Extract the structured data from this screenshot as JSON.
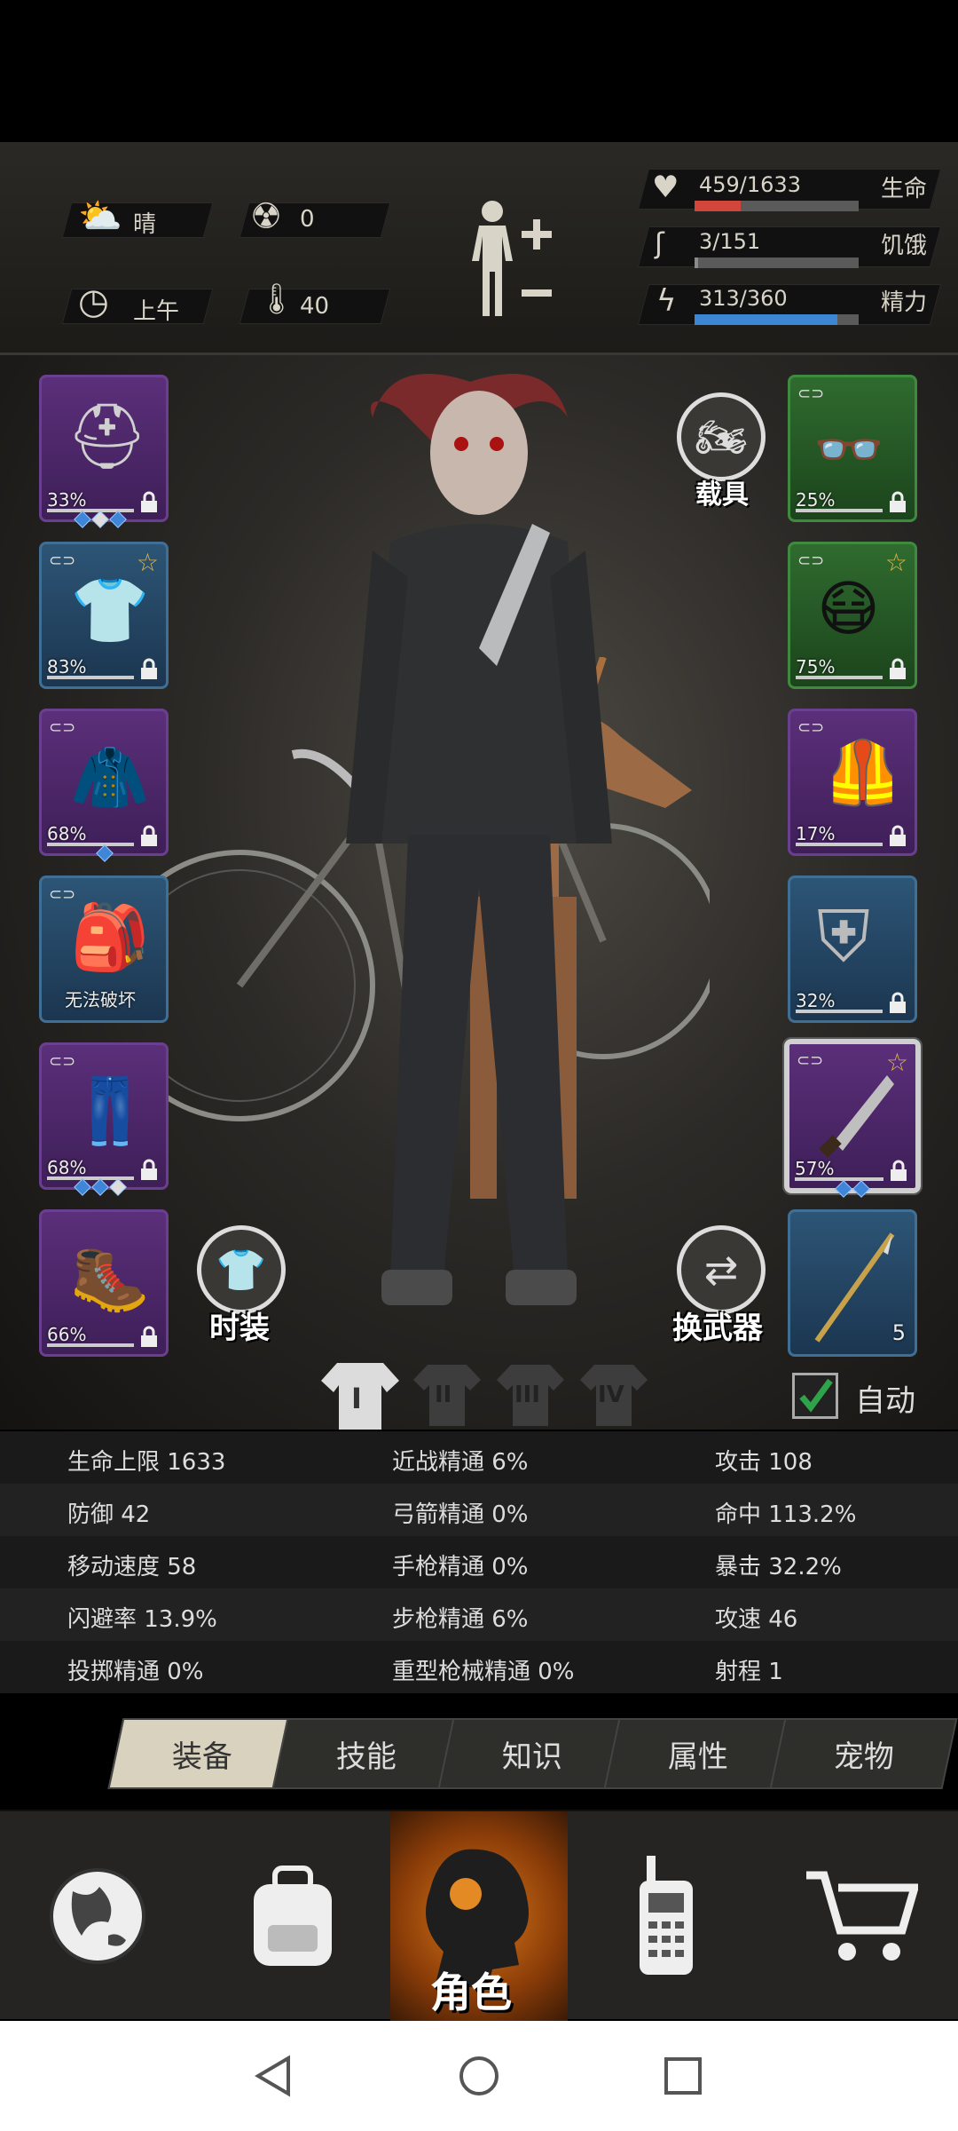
{
  "status": {
    "weather": "晴",
    "radiation": "0",
    "time_of_day": "上午",
    "temperature": "40",
    "hp": {
      "label": "生命",
      "text": "459/1633",
      "current": 459,
      "max": 1633,
      "color": "#d1453a"
    },
    "hunger": {
      "label": "饥饿",
      "text": "3/151",
      "current": 3,
      "max": 151,
      "color": "#8a8a8a"
    },
    "energy": {
      "label": "精力",
      "text": "313/360",
      "current": 313,
      "max": 360,
      "color": "#3d86d4"
    }
  },
  "equipment_left": [
    {
      "name": "helmet",
      "pct": "33%"
    },
    {
      "name": "shirt",
      "pct": "83%"
    },
    {
      "name": "jacket",
      "pct": "68%"
    },
    {
      "name": "backpack",
      "pct": "无法破坏"
    },
    {
      "name": "pants",
      "pct": "68%"
    },
    {
      "name": "boots",
      "pct": "66%"
    }
  ],
  "equipment_right": [
    {
      "name": "glasses",
      "pct": "25%"
    },
    {
      "name": "mask",
      "pct": "75%"
    },
    {
      "name": "vest",
      "pct": "17%"
    },
    {
      "name": "shield",
      "pct": "32%"
    },
    {
      "name": "machete",
      "pct": "57%"
    },
    {
      "name": "dart",
      "count": "5"
    }
  ],
  "buttons": {
    "vehicle": "载具",
    "fashion": "时装",
    "switch_weapon": "换武器",
    "auto": "自动"
  },
  "outfit_tabs": [
    "I",
    "II",
    "III",
    "IV"
  ],
  "stats": [
    [
      "生命上限 1633",
      "近战精通 6%",
      "攻击 108"
    ],
    [
      "防御 42",
      "弓箭精通 0%",
      "命中 113.2%"
    ],
    [
      "移动速度 58",
      "手枪精通 0%",
      "暴击 32.2%"
    ],
    [
      "闪避率 13.9%",
      "步枪精通 6%",
      "攻速 46"
    ],
    [
      "投掷精通 0%",
      "重型枪械精通 0%",
      "射程 1"
    ]
  ],
  "tabs": [
    "装备",
    "技能",
    "知识",
    "属性",
    "宠物"
  ],
  "nav": {
    "role_label": "角色"
  },
  "colors": {
    "accent": "#e38a1c",
    "rare": "#6b3f8f",
    "uncommon": "#3f6f95",
    "common": "#3e8a3e"
  }
}
